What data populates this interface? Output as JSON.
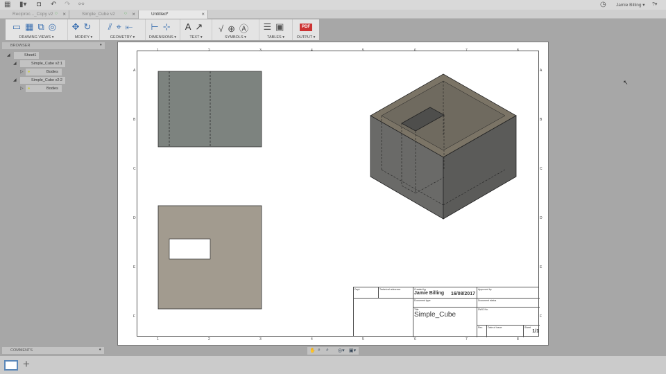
{
  "topbar": {
    "user": "Jamie Billing ▾",
    "help": "?▾"
  },
  "tabs": [
    {
      "label": "Reciproc..._Copy v2"
    },
    {
      "label": "Simple_Cube v2"
    },
    {
      "label": "Untitled*"
    }
  ],
  "toolbar": {
    "groups": [
      {
        "label": "DRAWING VIEWS ▾",
        "icons": "▭▦⧉◎"
      },
      {
        "label": "MODIFY ▾",
        "icons": "✥↻"
      },
      {
        "label": "GEOMETRY ▾",
        "icons": "⫽⌖⇤"
      },
      {
        "label": "DIMENSIONS ▾",
        "icons": "⊢⊹"
      },
      {
        "label": "TEXT ▾",
        "icons": "A↗"
      },
      {
        "label": "SYMBOLS ▾",
        "icons": "√⊕Ⓐ"
      },
      {
        "label": "TABLES ▾",
        "icons": "☰▣"
      },
      {
        "label": "OUTPUT ▾",
        "icons": "PDF"
      }
    ]
  },
  "browser": {
    "title": "BROWSER",
    "items": [
      "Sheet1",
      "Simple_Cube v2:1",
      "Bodies",
      "Simple_Cube v2:2",
      "Bodies"
    ]
  },
  "comments": "COMMENTS",
  "sheet": {
    "cols": [
      "1",
      "2",
      "3",
      "4",
      "5",
      "6",
      "7",
      "8"
    ],
    "rows": [
      "A",
      "B",
      "C",
      "D",
      "E",
      "F"
    ]
  },
  "titleblock": {
    "dept": "Dept.",
    "tech_ref": "Technical reference",
    "created_by_label": "Created by",
    "created_by": "Jamie Billing",
    "date": "16/08/2017",
    "approved_by": "Approved by",
    "doc_type": "Document type",
    "doc_status": "Document status",
    "title_label": "Title",
    "title": "Simple_Cube",
    "dwg_no": "DWG No.",
    "rev": "Rev.",
    "date_issue": "Date of issue",
    "sheet_label": "Sheet",
    "sheet": "1/1"
  }
}
